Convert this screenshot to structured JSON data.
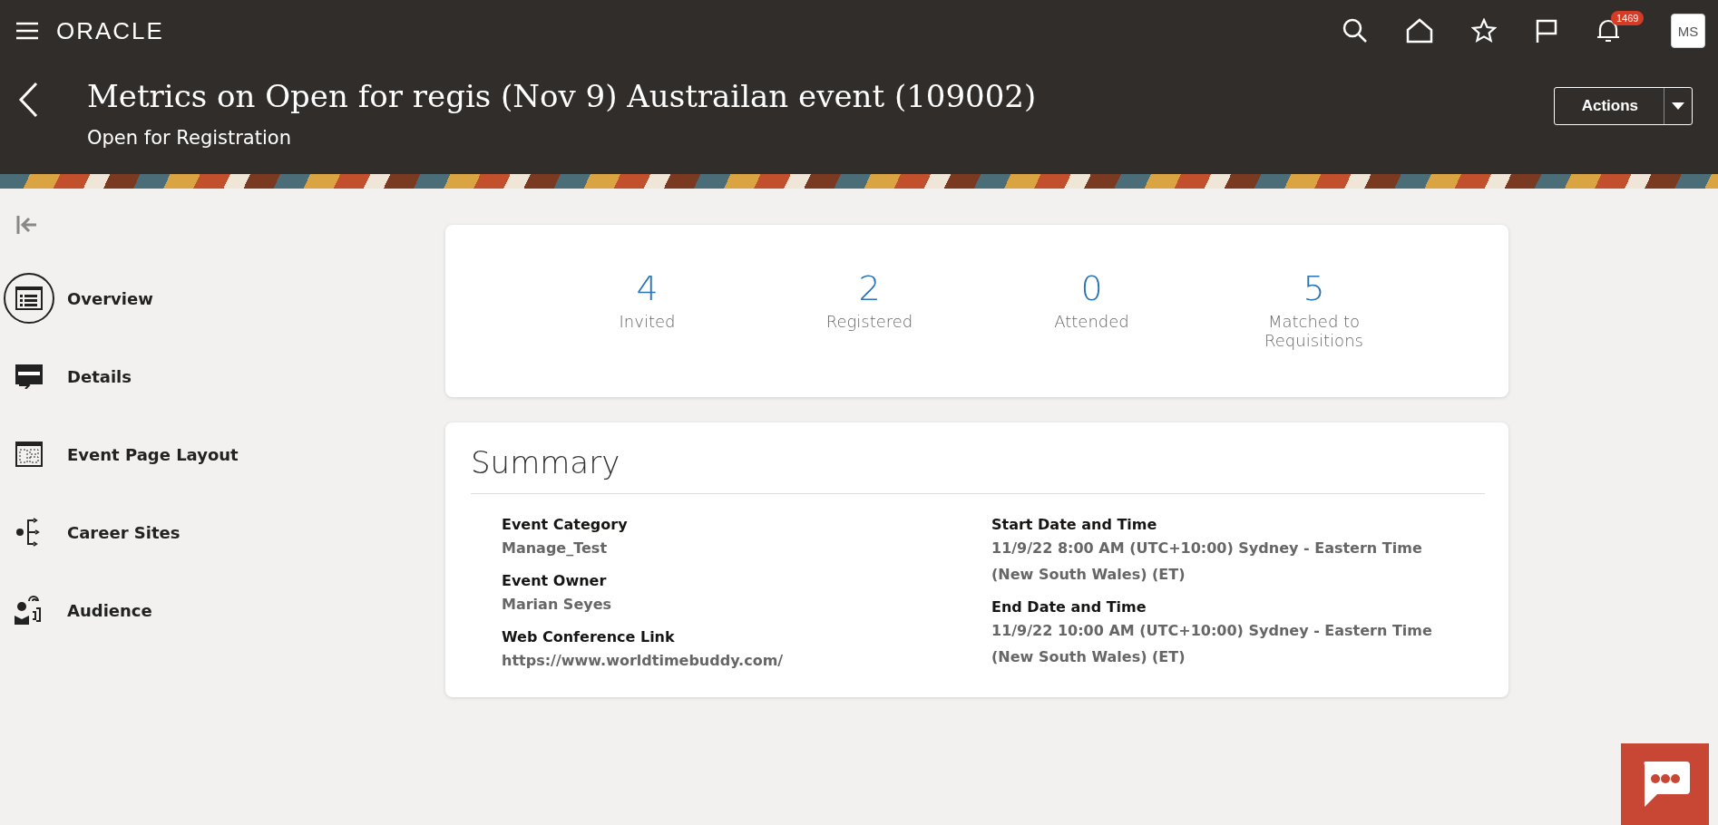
{
  "header": {
    "logo": "ORACLE",
    "notifications_count": "1469",
    "avatar_initials": "MS",
    "title": "Metrics on Open for regis (Nov 9) Austrailan event (109002)",
    "subtitle": "Open for Registration",
    "actions_label": "Actions"
  },
  "sidebar": {
    "items": [
      {
        "label": "Overview",
        "kind": "overview",
        "selected": true
      },
      {
        "label": "Details",
        "kind": "details",
        "selected": false
      },
      {
        "label": "Event Page Layout",
        "kind": "layout",
        "selected": false
      },
      {
        "label": "Career Sites",
        "kind": "sites",
        "selected": false
      },
      {
        "label": "Audience",
        "kind": "audience",
        "selected": false
      }
    ]
  },
  "metrics": [
    {
      "value": "4",
      "label": "Invited"
    },
    {
      "value": "2",
      "label": "Registered"
    },
    {
      "value": "0",
      "label": "Attended"
    },
    {
      "value": "5",
      "label": "Matched to Requisitions"
    }
  ],
  "summary": {
    "title": "Summary",
    "left": [
      {
        "label": "Event Category",
        "value": "Manage_Test"
      },
      {
        "label": "Event Owner",
        "value": "Marian Seyes"
      },
      {
        "label": "Web Conference Link",
        "value": "https://www.worldtimebuddy.com/"
      }
    ],
    "right": [
      {
        "label": "Start Date and Time",
        "value": "11/9/22 8:00 AM (UTC+10:00) Sydney - Eastern Time (New South Wales) (ET)"
      },
      {
        "label": "End Date and Time",
        "value": "11/9/22 10:00 AM (UTC+10:00) Sydney - Eastern Time (New South Wales) (ET)"
      }
    ]
  }
}
